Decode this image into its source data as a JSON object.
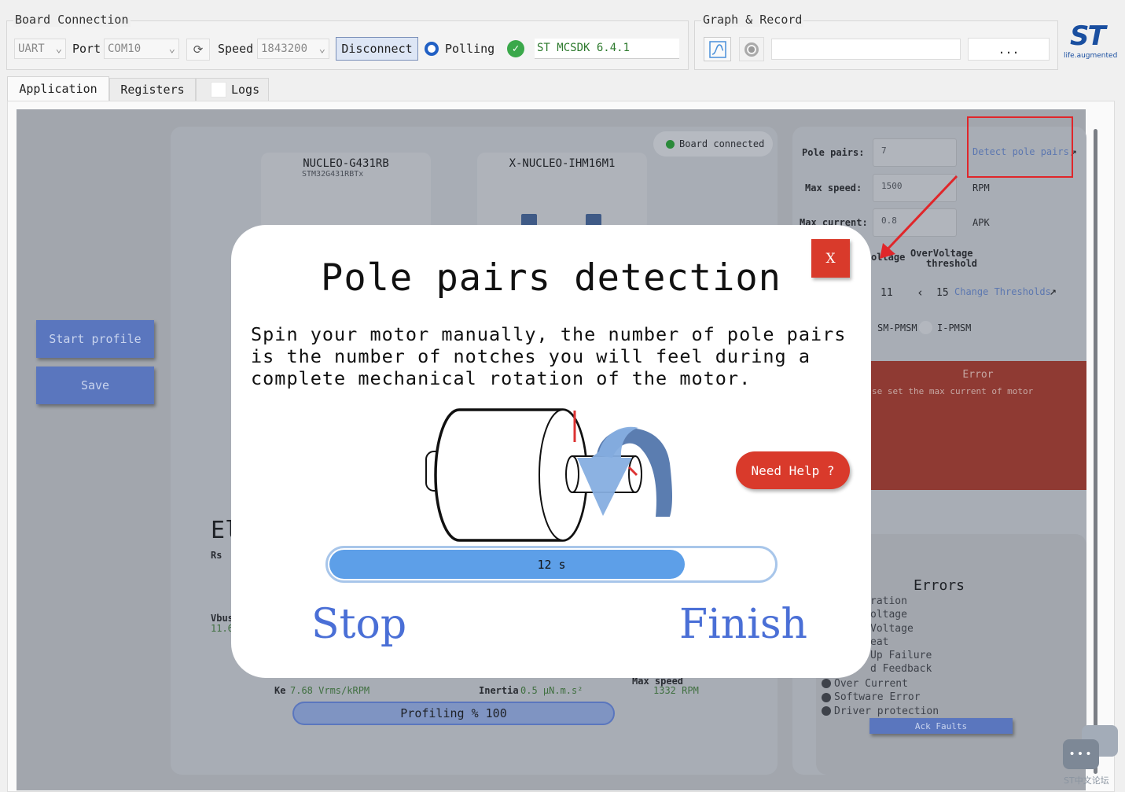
{
  "board_connection": {
    "title": "Board Connection",
    "interface": "UART",
    "port_label": "Port",
    "port": "COM10",
    "speed_label": "Speed",
    "speed": "1843200",
    "disconnect": "Disconnect",
    "polling": "Polling",
    "firmware": "ST MCSDK 6.4.1"
  },
  "graph_record": {
    "title": "Graph & Record",
    "browse": "..."
  },
  "logo": {
    "text": "ST",
    "tagline": "life.augmented"
  },
  "tabs": [
    "Application",
    "Registers",
    "Logs"
  ],
  "background": {
    "start_profile": "Start profile",
    "save": "Save",
    "board_connected": "Board connected",
    "board1_name": "NUCLEO-G431RB",
    "board1_mcu": "STM32G431RBTx",
    "board2_name": "X-NUCLEO-IHM16M1",
    "el_heading": "El",
    "rs_label": "Rs",
    "vbus_label": "Vbus",
    "vbus_value": "11.6",
    "ke_label": "Ke",
    "ke_value": "7.68 Vrms/kRPM",
    "inertia_label": "Inertia",
    "inertia_value": "0.5 μN.m.s²",
    "max_speed_label": "Max speed",
    "max_speed_value": "1332 RPM",
    "profiling": "Profiling % 100",
    "pole_pairs_label": "Pole pairs:",
    "pole_pairs_value": "7",
    "detect_pole_pairs": "Detect pole pairs",
    "max_speed_field_label": "Max speed:",
    "max_speed_field_value": "1500",
    "rpm": "RPM",
    "max_current_label": "Max current:",
    "max_current_value": "0.8",
    "apk": "APK",
    "undervoltage": "oltage",
    "overvoltage": "OverVoltage",
    "threshold": "threshold",
    "uv_value": "11",
    "ov_value": "15",
    "change_thresholds": "Change Thresholds",
    "sm_pmsm": "SM-PMSM",
    "i_pmsm": "I-PMSM",
    "error_title": "Error",
    "error_message": "se set the max current of motor",
    "errors_heading": "Errors",
    "error_items": [
      "ration",
      "oltage",
      "Voltage",
      "eat",
      "Up Failure",
      "d Feedback",
      "Over Current",
      "Software Error",
      "Driver protection"
    ],
    "ack_faults": "Ack Faults"
  },
  "modal": {
    "title": "Pole pairs detection",
    "close": "X",
    "description": "Spin your motor manually, the number of pole pairs is the number of notches you will feel during a complete mechanical rotation of the motor.",
    "need_help": "Need Help ?",
    "progress_text": "12 s",
    "progress_fraction": 0.8,
    "stop": "Stop",
    "finish": "Finish"
  },
  "watermark": "ST中文论坛",
  "colors": {
    "accent_blue": "#5d9fe8",
    "error_red": "#d93a2b",
    "link_blue": "#4a6fd6",
    "annotation_red": "#e0262a"
  }
}
